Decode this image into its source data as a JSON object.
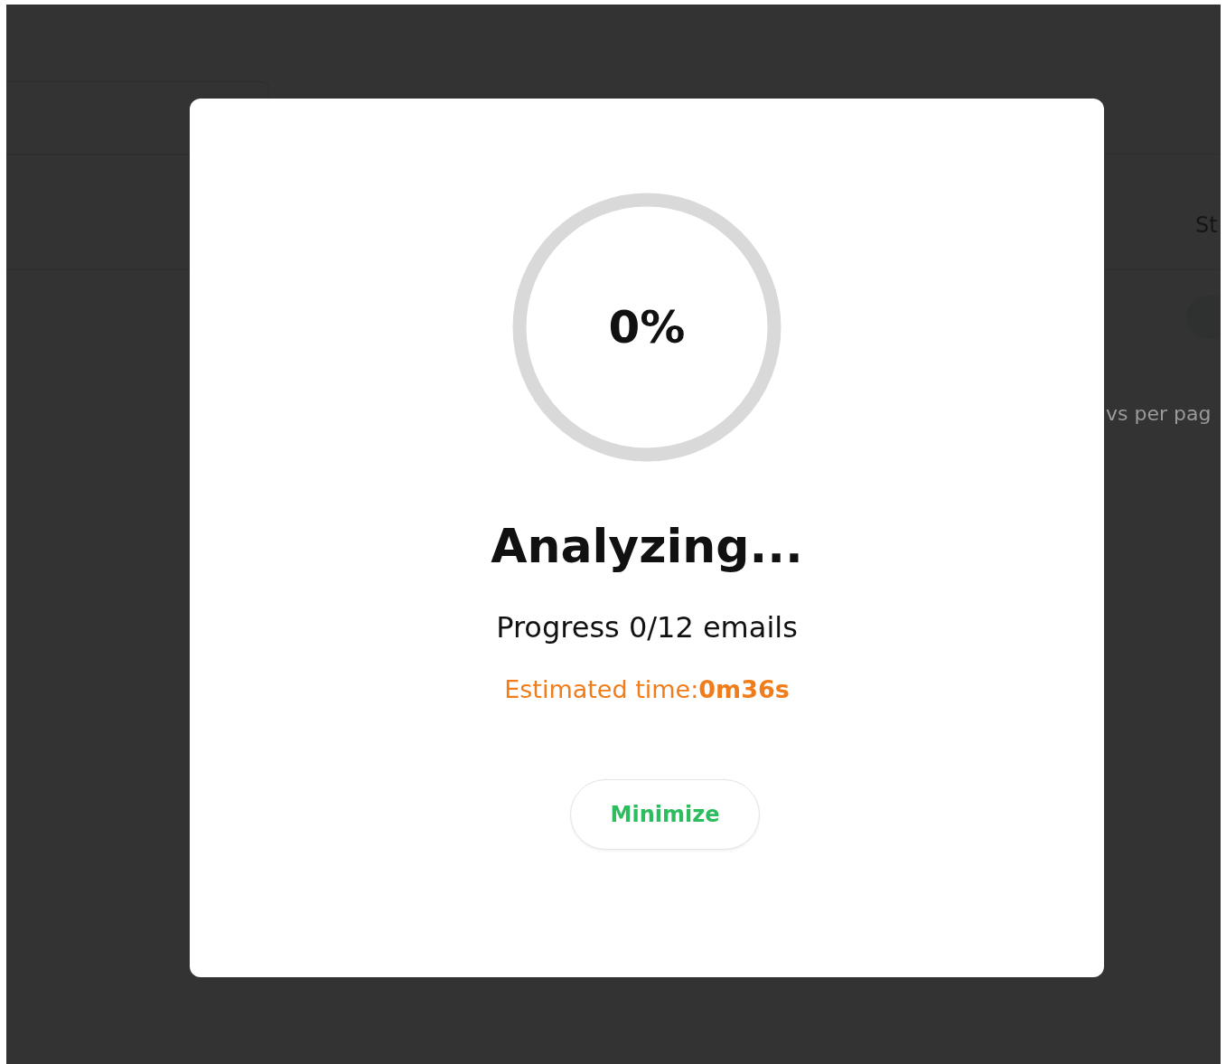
{
  "background": {
    "column_heading": "St",
    "rows_label": "vs per pag"
  },
  "dialog": {
    "progress": {
      "reading": "0%"
    },
    "title": "Analyzing...",
    "progress_text": "Progress 0/12 emails",
    "estimate": "Estimated time:**0m36s**",
    "button": "Minimize"
  }
}
